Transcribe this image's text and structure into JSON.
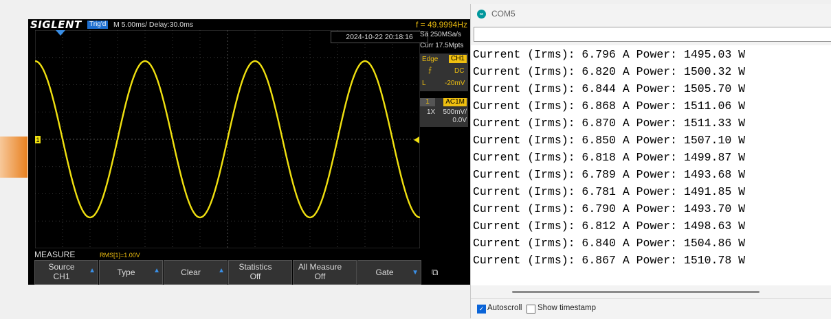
{
  "scope": {
    "brand": "SIGLENT",
    "trig_status": "Trig'd",
    "timebase": "M 5.00ms/ Delay:30.0ms",
    "frequency": "f = 49.9994Hz",
    "datetime": "2024-10-22 20:18:16",
    "sample_rate": "Sa 250MSa/s",
    "curr_points": "Curr 17.5Mpts",
    "trigger": {
      "type": "Edge",
      "source": "CH1",
      "coupling": "DC",
      "level_label": "L",
      "level": "-20mV"
    },
    "channel": {
      "number": "1",
      "coupling": "AC1M",
      "probe": "1X",
      "scale": "500mV/",
      "offset": "0.0V"
    },
    "channel_marker": "1",
    "measure_label": "MEASURE",
    "measure_value": "RMS[1]=1.00V",
    "softkeys": [
      {
        "line1": "Source",
        "line2": "CH1"
      },
      {
        "line1": "Type",
        "line2": ""
      },
      {
        "line1": "Clear",
        "line2": ""
      },
      {
        "line1": "Statistics",
        "line2": "Off"
      },
      {
        "line1": "All Measure",
        "line2": "Off"
      },
      {
        "line1": "Gate",
        "line2": ""
      }
    ],
    "waveform": {
      "cycles_visible": 3.5,
      "color": "#f0e010"
    },
    "colors": {
      "accent": "#f0c010",
      "trig_badge": "#1e6fd0"
    }
  },
  "serial_monitor": {
    "title": "COM5",
    "input_value": "",
    "lines": [
      "Current (Irms): 6.796 A Power: 1495.03 W",
      "Current (Irms): 6.820 A Power: 1500.32 W",
      "Current (Irms): 6.844 A Power: 1505.70 W",
      "Current (Irms): 6.868 A Power: 1511.06 W",
      "Current (Irms): 6.870 A Power: 1511.33 W",
      "Current (Irms): 6.850 A Power: 1507.10 W",
      "Current (Irms): 6.818 A Power: 1499.87 W",
      "Current (Irms): 6.789 A Power: 1493.68 W",
      "Current (Irms): 6.781 A Power: 1491.85 W",
      "Current (Irms): 6.790 A Power: 1493.70 W",
      "Current (Irms): 6.812 A Power: 1498.63 W",
      "Current (Irms): 6.840 A Power: 1504.86 W",
      "Current (Irms): 6.867 A Power: 1510.78 W"
    ],
    "autoscroll": {
      "label": "Autoscroll",
      "checked": true
    },
    "timestamp": {
      "label": "Show timestamp",
      "checked": false
    }
  }
}
